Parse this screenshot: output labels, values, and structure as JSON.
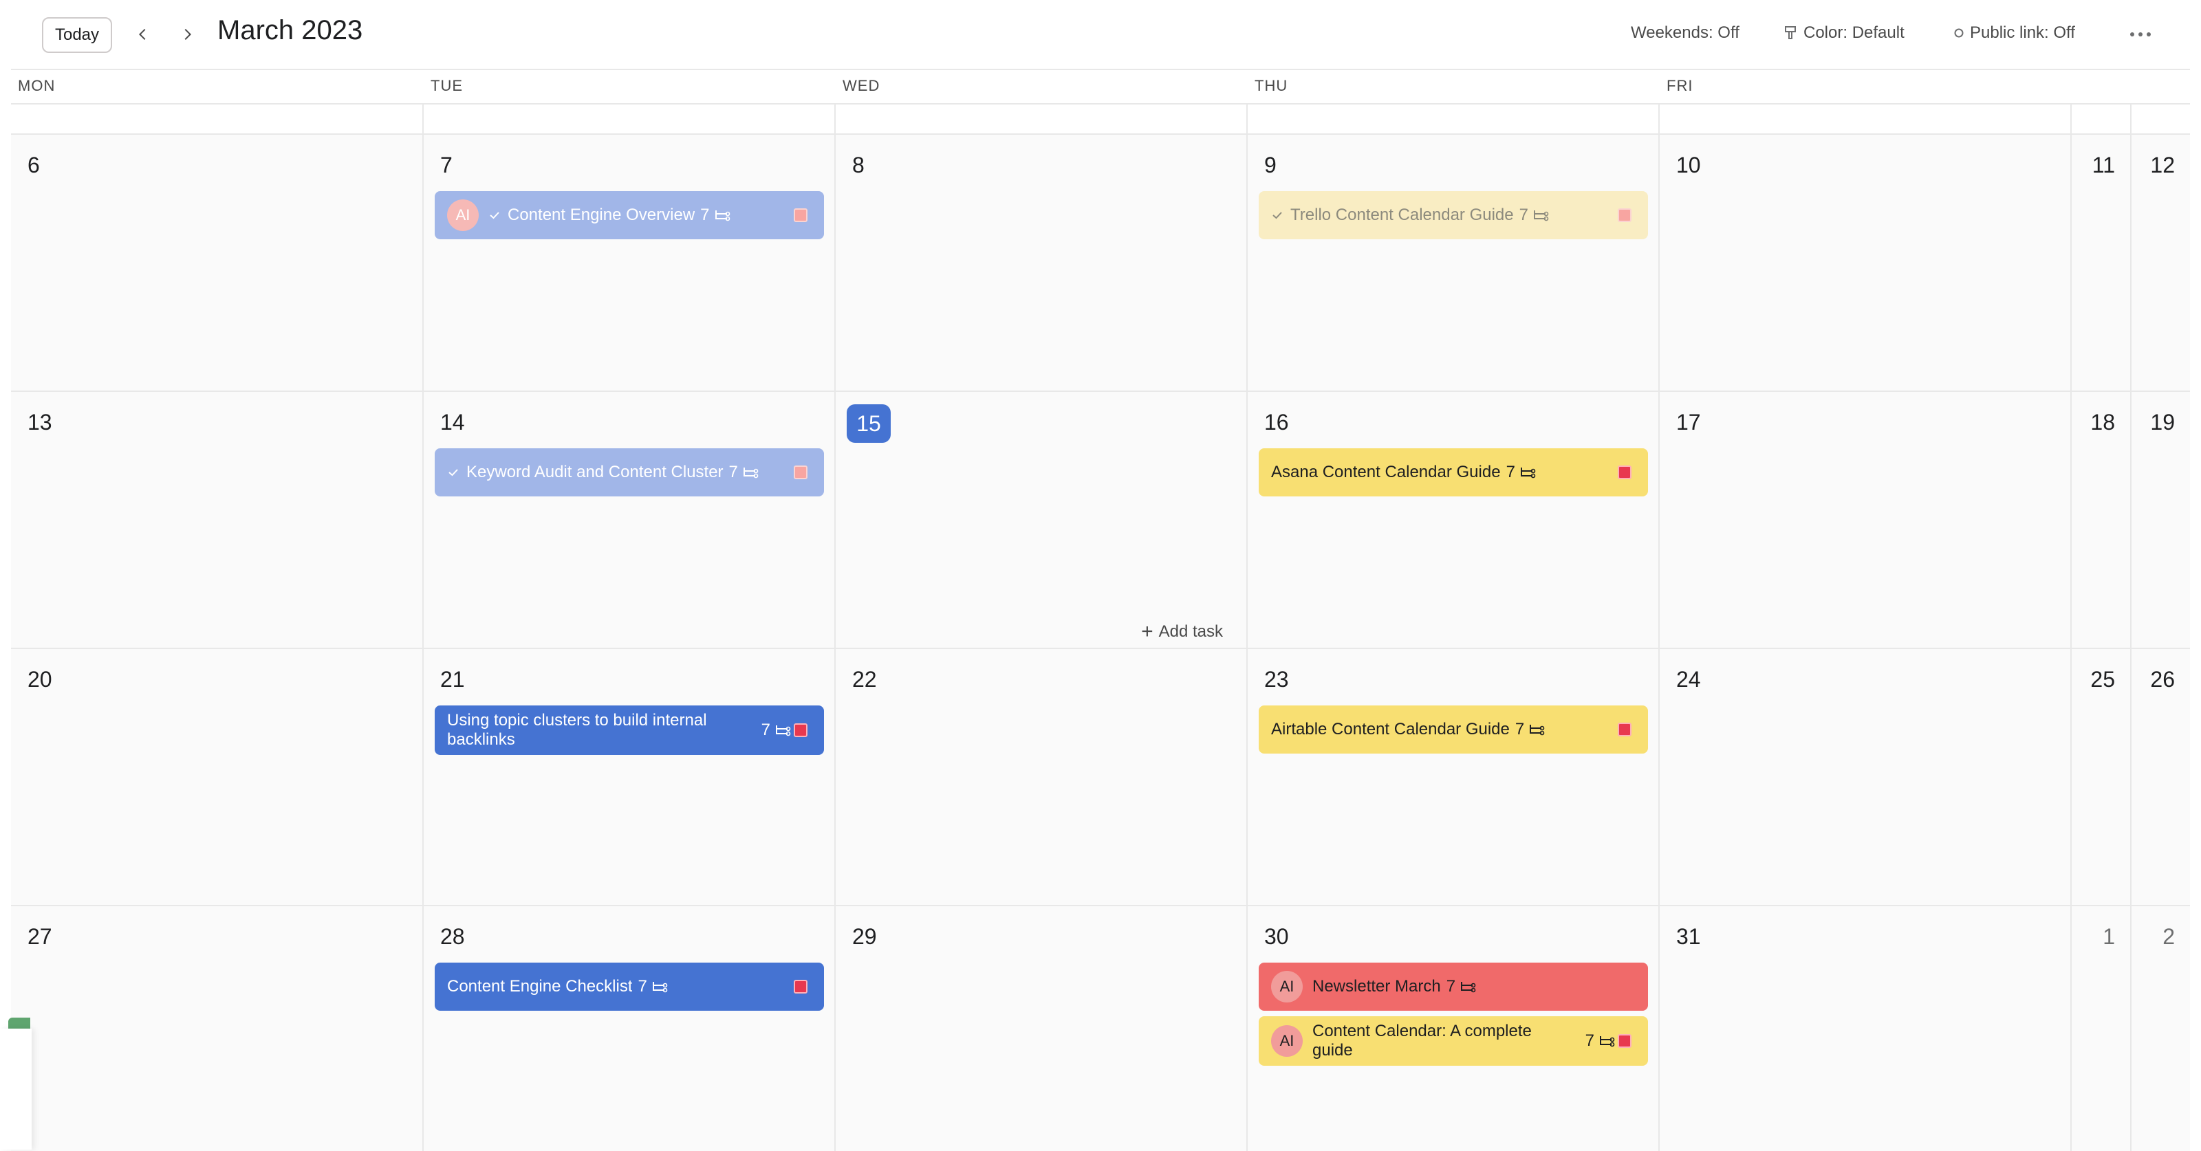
{
  "toolbar": {
    "today_label": "Today",
    "month_title": "March 2023",
    "weekends": "Weekends: Off",
    "color": "Color: Default",
    "public_link": "Public link: Off"
  },
  "days_of_week": [
    "MON",
    "TUE",
    "WED",
    "THU",
    "FRI"
  ],
  "weeks": [
    {
      "days": [
        "6",
        "7",
        "8",
        "9",
        "10",
        "11",
        "12"
      ]
    },
    {
      "days": [
        "13",
        "14",
        "15",
        "16",
        "17",
        "18",
        "19"
      ]
    },
    {
      "days": [
        "20",
        "21",
        "22",
        "23",
        "24",
        "25",
        "26"
      ]
    },
    {
      "days": [
        "27",
        "28",
        "29",
        "30",
        "31",
        "1",
        "2"
      ]
    }
  ],
  "today": "15",
  "add_task_label": "Add task",
  "tasks": {
    "content_engine_overview": {
      "title": "Content Engine Overview",
      "count": "7",
      "avatar": "AI"
    },
    "trello_guide": {
      "title": "Trello Content Calendar Guide",
      "count": "7"
    },
    "keyword_audit": {
      "title": "Keyword Audit and Content Cluster",
      "count": "7"
    },
    "asana_guide": {
      "title": "Asana Content Calendar Guide",
      "count": "7"
    },
    "topic_clusters": {
      "title": "Using topic clusters to build internal backlinks",
      "count": "7"
    },
    "airtable_guide": {
      "title": "Airtable Content Calendar Guide",
      "count": "7"
    },
    "engine_checklist": {
      "title": "Content Engine Checklist",
      "count": "7"
    },
    "newsletter": {
      "title": "Newsletter March",
      "count": "7",
      "avatar": "AI"
    },
    "complete_guide": {
      "title": "Content Calendar: A complete guide",
      "count": "7",
      "avatar": "AI"
    }
  },
  "colors": {
    "accent_blue": "#4573d2",
    "light_blue": "#a1b6e8",
    "yellow": "#f8df72",
    "light_yellow": "#f9edc3",
    "red": "#f06a6a"
  },
  "icons": [
    "chevron-left-icon",
    "chevron-right-icon",
    "paint-brush-icon",
    "circle-icon",
    "more-icon",
    "check-icon",
    "subtask-icon",
    "plus-icon"
  ]
}
